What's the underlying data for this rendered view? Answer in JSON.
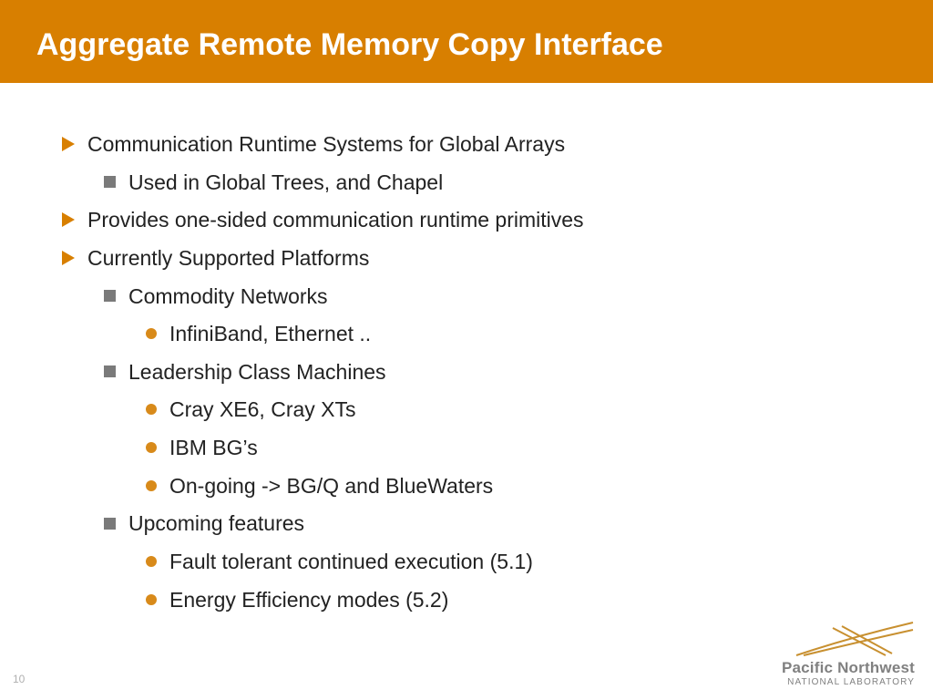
{
  "header": {
    "title": "Aggregate Remote Memory Copy Interface"
  },
  "bullets": {
    "b1": "Communication Runtime Systems for Global Arrays",
    "b1a": "Used in Global Trees, and Chapel",
    "b2": "Provides one-sided communication runtime primitives",
    "b3": "Currently Supported Platforms",
    "b3a": "Commodity Networks",
    "b3a1": "InfiniBand, Ethernet ..",
    "b3b": "Leadership Class Machines",
    "b3b1": "Cray XE6, Cray XTs",
    "b3b2": "IBM BG’s",
    "b3b3": "On-going -> BG/Q and BlueWaters",
    "b3c": "Upcoming features",
    "b3c1": "Fault tolerant continued execution (5.1)",
    "b3c2": "Energy Efficiency modes (5.2)"
  },
  "page": "10",
  "logo": {
    "line1": "Pacific Northwest",
    "line2": "NATIONAL LABORATORY"
  }
}
